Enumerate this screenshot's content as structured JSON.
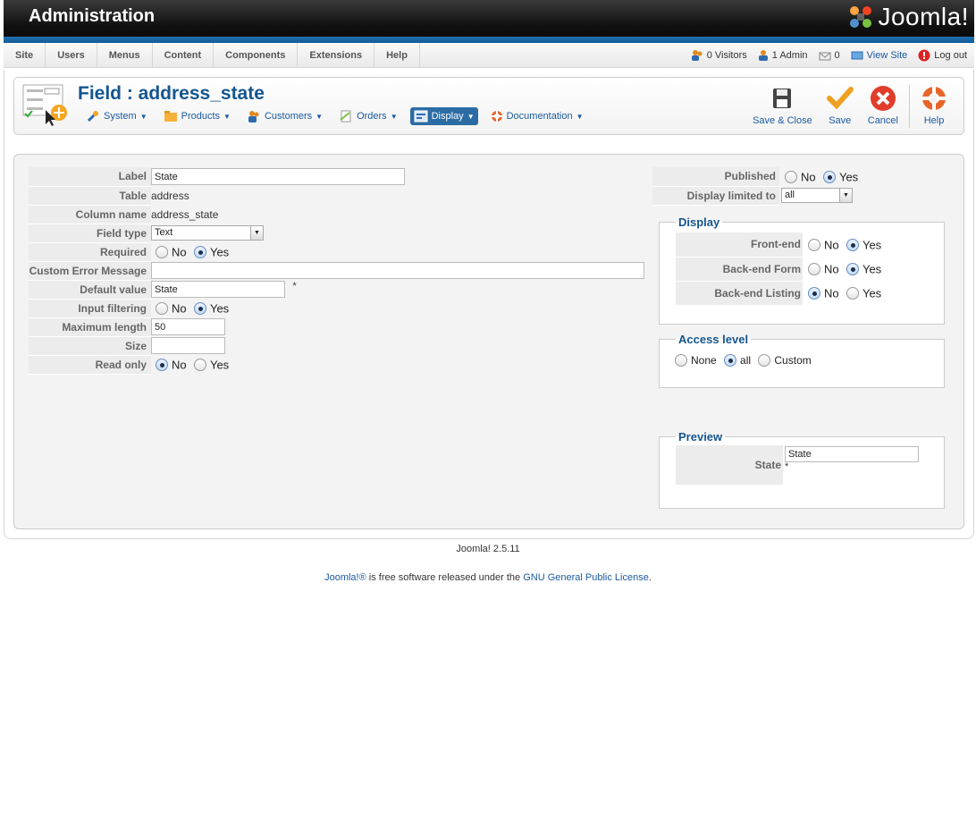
{
  "header": {
    "title": "Administration",
    "brand": "Joomla!"
  },
  "menu": {
    "items": [
      "Site",
      "Users",
      "Menus",
      "Content",
      "Components",
      "Extensions",
      "Help"
    ]
  },
  "status": {
    "visitors": "0 Visitors",
    "admins": "1 Admin",
    "messages": "0",
    "view_site": "View Site",
    "logout": "Log out"
  },
  "toolbar": {
    "page_title": "Field : address_state",
    "submenu": [
      {
        "label": "System",
        "icon": "wrench-icon"
      },
      {
        "label": "Products",
        "icon": "products-folder-icon"
      },
      {
        "label": "Customers",
        "icon": "customers-icon"
      },
      {
        "label": "Orders",
        "icon": "orders-icon"
      },
      {
        "label": "Display",
        "icon": "display-icon",
        "active": true
      },
      {
        "label": "Documentation",
        "icon": "lifebuoy-icon"
      }
    ],
    "buttons": {
      "save_close": "Save & Close",
      "save": "Save",
      "cancel": "Cancel",
      "help": "Help"
    }
  },
  "form": {
    "label": {
      "label": "Label",
      "value": "State"
    },
    "table": {
      "label": "Table",
      "value": "address"
    },
    "column_name": {
      "label": "Column name",
      "value": "address_state"
    },
    "field_type": {
      "label": "Field type",
      "value": "Text"
    },
    "required": {
      "label": "Required",
      "no": "No",
      "yes": "Yes",
      "selected": "Yes"
    },
    "custom_error": {
      "label": "Custom Error Message",
      "value": ""
    },
    "default_value": {
      "label": "Default value",
      "value": "State",
      "marker": "*"
    },
    "input_filtering": {
      "label": "Input filtering",
      "no": "No",
      "yes": "Yes",
      "selected": "Yes"
    },
    "max_length": {
      "label": "Maximum length",
      "value": "50"
    },
    "size": {
      "label": "Size",
      "value": ""
    },
    "read_only": {
      "label": "Read only",
      "no": "No",
      "yes": "Yes",
      "selected": "No"
    }
  },
  "right": {
    "published": {
      "label": "Published",
      "no": "No",
      "yes": "Yes",
      "selected": "Yes"
    },
    "display_limited": {
      "label": "Display limited to",
      "value": "all"
    },
    "display": {
      "legend": "Display",
      "front_end": {
        "label": "Front-end",
        "no": "No",
        "yes": "Yes",
        "selected": "Yes"
      },
      "backend_form": {
        "label": "Back-end Form",
        "no": "No",
        "yes": "Yes",
        "selected": "Yes"
      },
      "backend_listing": {
        "label": "Back-end Listing",
        "no": "No",
        "yes": "Yes",
        "selected": "No"
      }
    },
    "access": {
      "legend": "Access level",
      "none": "None",
      "all": "all",
      "custom": "Custom",
      "selected": "all"
    },
    "preview": {
      "legend": "Preview",
      "label": "State",
      "value": "State",
      "marker": "*"
    }
  },
  "footer": {
    "version": "Joomla! 2.5.11",
    "brand_link": "Joomla!®",
    "text": " is free software released under the ",
    "license_link": "GNU General Public License",
    "end": "."
  },
  "colors": {
    "accent": "#14558f",
    "link": "#1b5aa0",
    "header_bg": "#111111",
    "header_stripe": "#1f6fb0"
  }
}
